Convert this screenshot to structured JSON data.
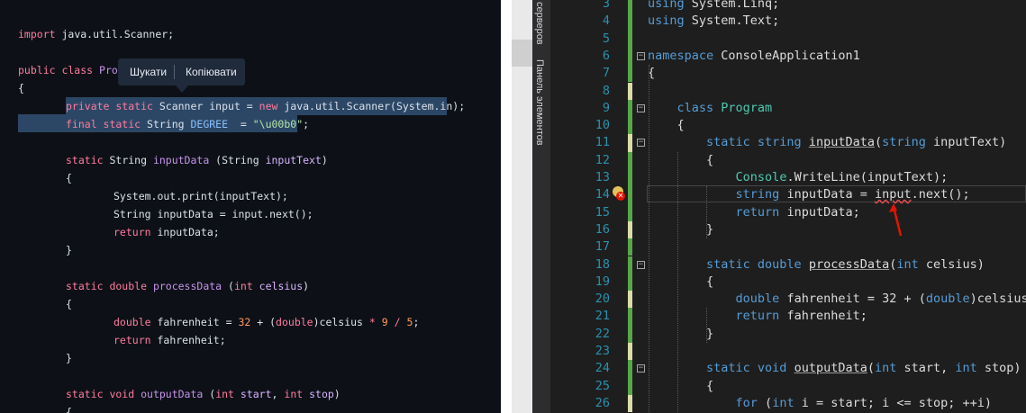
{
  "left_editor": {
    "lines": [
      {
        "id": "l1",
        "indent": 0,
        "tokens": [
          [
            "import ",
            "kw-l"
          ],
          [
            "java.util.Scanner;",
            ""
          ]
        ]
      },
      {
        "id": "l2",
        "indent": 0,
        "tokens": [
          [
            "public class ",
            "kw-l"
          ],
          [
            "Prog",
            "cls-l"
          ]
        ]
      },
      {
        "id": "l3",
        "indent": 0,
        "tokens": [
          [
            "{",
            ""
          ]
        ]
      },
      {
        "id": "l4",
        "indent": 1,
        "tokens": [
          [
            "private static ",
            "kw-l"
          ],
          [
            "Scanner input = ",
            ""
          ],
          [
            "new ",
            "kw-l"
          ],
          [
            "java.util.Scanner(System.in);",
            ""
          ]
        ]
      },
      {
        "id": "l5",
        "indent": 1,
        "tokens": [
          [
            "final static ",
            "kw-l"
          ],
          [
            "String ",
            ""
          ],
          [
            "DEGREE",
            "const-l"
          ],
          [
            "  = ",
            ""
          ],
          [
            "\"\\u00b0\"",
            "str-l"
          ],
          [
            ";",
            ""
          ]
        ]
      },
      {
        "id": "l6",
        "indent": 1,
        "tokens": [
          [
            "static ",
            "kw-l"
          ],
          [
            "String ",
            ""
          ],
          [
            "inputData",
            "fn-l"
          ],
          [
            " (String ",
            ""
          ],
          [
            "inputText",
            "par-l"
          ],
          [
            ")",
            ""
          ]
        ]
      },
      {
        "id": "l7",
        "indent": 1,
        "tokens": [
          [
            "{",
            ""
          ]
        ]
      },
      {
        "id": "l8",
        "indent": 2,
        "tokens": [
          [
            "System.out.print(inputText);",
            ""
          ]
        ]
      },
      {
        "id": "l9",
        "indent": 2,
        "tokens": [
          [
            "String ",
            ""
          ],
          [
            "inputData = input.next();",
            ""
          ]
        ]
      },
      {
        "id": "l10",
        "indent": 2,
        "tokens": [
          [
            "return ",
            "kw-l"
          ],
          [
            "inputData;",
            ""
          ]
        ]
      },
      {
        "id": "l11",
        "indent": 1,
        "tokens": [
          [
            "}",
            ""
          ]
        ]
      },
      {
        "id": "l12",
        "indent": 1,
        "tokens": [
          [
            "static double ",
            "kw-l"
          ],
          [
            "processData",
            "fn-l"
          ],
          [
            " (",
            ""
          ],
          [
            "int ",
            "kw-l"
          ],
          [
            "celsius",
            "par-l"
          ],
          [
            ")",
            ""
          ]
        ]
      },
      {
        "id": "l13",
        "indent": 1,
        "tokens": [
          [
            "{",
            ""
          ]
        ]
      },
      {
        "id": "l14",
        "indent": 2,
        "tokens": [
          [
            "double ",
            "kw-l"
          ],
          [
            "fahrenheit = ",
            ""
          ],
          [
            "32",
            "num-l"
          ],
          [
            " + (",
            ""
          ],
          [
            "double",
            "kw-l"
          ],
          [
            ")celsius ",
            ""
          ],
          [
            "*",
            "op-l"
          ],
          [
            " ",
            ""
          ],
          [
            "9",
            "num-l"
          ],
          [
            " ",
            ""
          ],
          [
            "/",
            "op-l"
          ],
          [
            " ",
            ""
          ],
          [
            "5",
            "num-l"
          ],
          [
            ";",
            ""
          ]
        ]
      },
      {
        "id": "l15",
        "indent": 2,
        "tokens": [
          [
            "return ",
            "kw-l"
          ],
          [
            "fahrenheit;",
            ""
          ]
        ]
      },
      {
        "id": "l16",
        "indent": 1,
        "tokens": [
          [
            "}",
            ""
          ]
        ]
      },
      {
        "id": "l17",
        "indent": 1,
        "tokens": [
          [
            "static void ",
            "kw-l"
          ],
          [
            "outputData",
            "fn-l"
          ],
          [
            " (",
            ""
          ],
          [
            "int ",
            "kw-l"
          ],
          [
            "start",
            "par-l"
          ],
          [
            ", ",
            ""
          ],
          [
            "int ",
            "kw-l"
          ],
          [
            "stop",
            "par-l"
          ],
          [
            ")",
            ""
          ]
        ]
      },
      {
        "id": "l18",
        "indent": 1,
        "tokens": [
          [
            "{",
            ""
          ]
        ]
      }
    ]
  },
  "popup": {
    "search_label": "Шукати",
    "copy_label": "Копіювати"
  },
  "tool_tabs": {
    "servers": "серверов",
    "toolbox": "Панель элементов"
  },
  "vs_editor": {
    "lines": [
      {
        "n": "3",
        "tokens": [
          [
            "using ",
            "kw"
          ],
          [
            "System.Linq;",
            ""
          ]
        ]
      },
      {
        "n": "4",
        "tokens": [
          [
            "using ",
            "kw"
          ],
          [
            "System.Text;",
            ""
          ]
        ]
      },
      {
        "n": "5",
        "tokens": []
      },
      {
        "n": "6",
        "tokens": [
          [
            "namespace ",
            "kw"
          ],
          [
            "ConsoleApplication1",
            ""
          ]
        ]
      },
      {
        "n": "7",
        "tokens": [
          [
            "{",
            ""
          ]
        ]
      },
      {
        "n": "8",
        "tokens": []
      },
      {
        "n": "9",
        "tokens": [
          [
            "    class ",
            "kw"
          ],
          [
            "Program",
            "tp"
          ]
        ]
      },
      {
        "n": "10",
        "tokens": [
          [
            "    {",
            ""
          ]
        ]
      },
      {
        "n": "11",
        "tokens": [
          [
            "        static string ",
            "kw"
          ],
          [
            "inputData",
            "ul"
          ],
          [
            "(",
            ""
          ],
          [
            "string ",
            "kw"
          ],
          [
            "inputText)",
            ""
          ]
        ]
      },
      {
        "n": "12",
        "tokens": [
          [
            "        {",
            ""
          ]
        ]
      },
      {
        "n": "13",
        "tokens": [
          [
            "            ",
            ""
          ],
          [
            "Console",
            "tp"
          ],
          [
            ".WriteLine(inputText);",
            ""
          ]
        ]
      },
      {
        "n": "14",
        "tokens": [
          [
            "            string ",
            "kw"
          ],
          [
            "inputData = ",
            ""
          ],
          [
            "input",
            "err"
          ],
          [
            ".next();",
            ""
          ]
        ]
      },
      {
        "n": "15",
        "tokens": [
          [
            "            return ",
            "kw"
          ],
          [
            "inputData;",
            ""
          ]
        ]
      },
      {
        "n": "16",
        "tokens": [
          [
            "        }",
            ""
          ]
        ]
      },
      {
        "n": "17",
        "tokens": []
      },
      {
        "n": "18",
        "tokens": [
          [
            "        static double ",
            "kw"
          ],
          [
            "processData",
            "ul"
          ],
          [
            "(",
            ""
          ],
          [
            "int ",
            "kw"
          ],
          [
            "celsius)",
            ""
          ]
        ]
      },
      {
        "n": "19",
        "tokens": [
          [
            "        {",
            ""
          ]
        ]
      },
      {
        "n": "20",
        "tokens": [
          [
            "            double ",
            "kw"
          ],
          [
            "fahrenheit = 32 + (",
            ""
          ],
          [
            "double",
            "kw"
          ],
          [
            ")celsius",
            ""
          ]
        ]
      },
      {
        "n": "21",
        "tokens": [
          [
            "            return ",
            "kw"
          ],
          [
            "fahrenheit;",
            ""
          ]
        ]
      },
      {
        "n": "22",
        "tokens": [
          [
            "        }",
            ""
          ]
        ]
      },
      {
        "n": "23",
        "tokens": []
      },
      {
        "n": "24",
        "tokens": [
          [
            "        static void ",
            "kw"
          ],
          [
            "outputData",
            "ul"
          ],
          [
            "(",
            ""
          ],
          [
            "int ",
            "kw"
          ],
          [
            "start, ",
            ""
          ],
          [
            "int ",
            "kw"
          ],
          [
            "stop)",
            ""
          ]
        ]
      },
      {
        "n": "25",
        "tokens": [
          [
            "        {",
            ""
          ]
        ]
      },
      {
        "n": "26",
        "tokens": [
          [
            "            for ",
            "kw"
          ],
          [
            "(",
            ""
          ],
          [
            "int ",
            "kw"
          ],
          [
            "i = start; i <= stop; ++i)",
            ""
          ]
        ]
      }
    ]
  }
}
